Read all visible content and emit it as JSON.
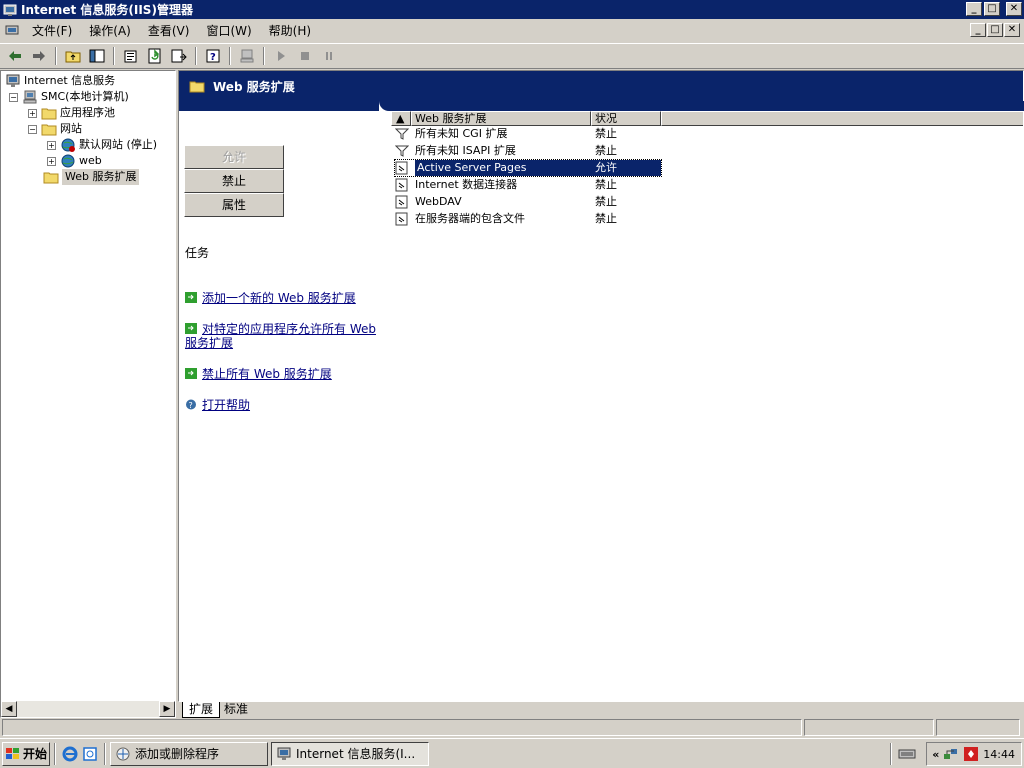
{
  "window": {
    "title": "Internet 信息服务(IIS)管理器",
    "min": "_",
    "max": "□",
    "close": "✕"
  },
  "menu": {
    "items": [
      "文件(F)",
      "操作(A)",
      "查看(V)",
      "窗口(W)",
      "帮助(H)"
    ]
  },
  "tree": {
    "root": "Internet 信息服务",
    "computer": "SMC(本地计算机)",
    "apppools": "应用程序池",
    "websites": "网站",
    "default_site": "默认网站 (停止)",
    "web_site": "web",
    "web_service_ext": "Web 服务扩展"
  },
  "banner": {
    "title": "Web 服务扩展"
  },
  "actions": {
    "allow": "允许",
    "prohibit": "禁止",
    "properties": "属性"
  },
  "tasks": {
    "header": "任务",
    "items": [
      "添加一个新的 Web 服务扩展",
      "对特定的应用程序允许所有 Web 服务扩展",
      "禁止所有 Web 服务扩展",
      "打开帮助"
    ]
  },
  "list": {
    "columns": [
      "Web 服务扩展",
      "状况"
    ],
    "rows": [
      {
        "name": "所有未知 CGI 扩展",
        "status": "禁止",
        "icon": "filter-icon"
      },
      {
        "name": "所有未知 ISAPI 扩展",
        "status": "禁止",
        "icon": "filter-icon"
      },
      {
        "name": "Active Server Pages",
        "status": "允许",
        "icon": "extension-icon",
        "selected": true
      },
      {
        "name": "Internet 数据连接器",
        "status": "禁止",
        "icon": "extension-icon"
      },
      {
        "name": "WebDAV",
        "status": "禁止",
        "icon": "extension-icon"
      },
      {
        "name": "在服务器端的包含文件",
        "status": "禁止",
        "icon": "extension-icon"
      }
    ]
  },
  "tabs": [
    "扩展",
    "标准"
  ],
  "taskbar": {
    "start": "开始",
    "items": [
      "添加或删除程序",
      "Internet 信息服务(I..."
    ],
    "clock": "14:44",
    "chevron": "«"
  },
  "colors": {
    "titlebar": "#0a246a",
    "face": "#d4d0c8",
    "link": "#000080"
  }
}
